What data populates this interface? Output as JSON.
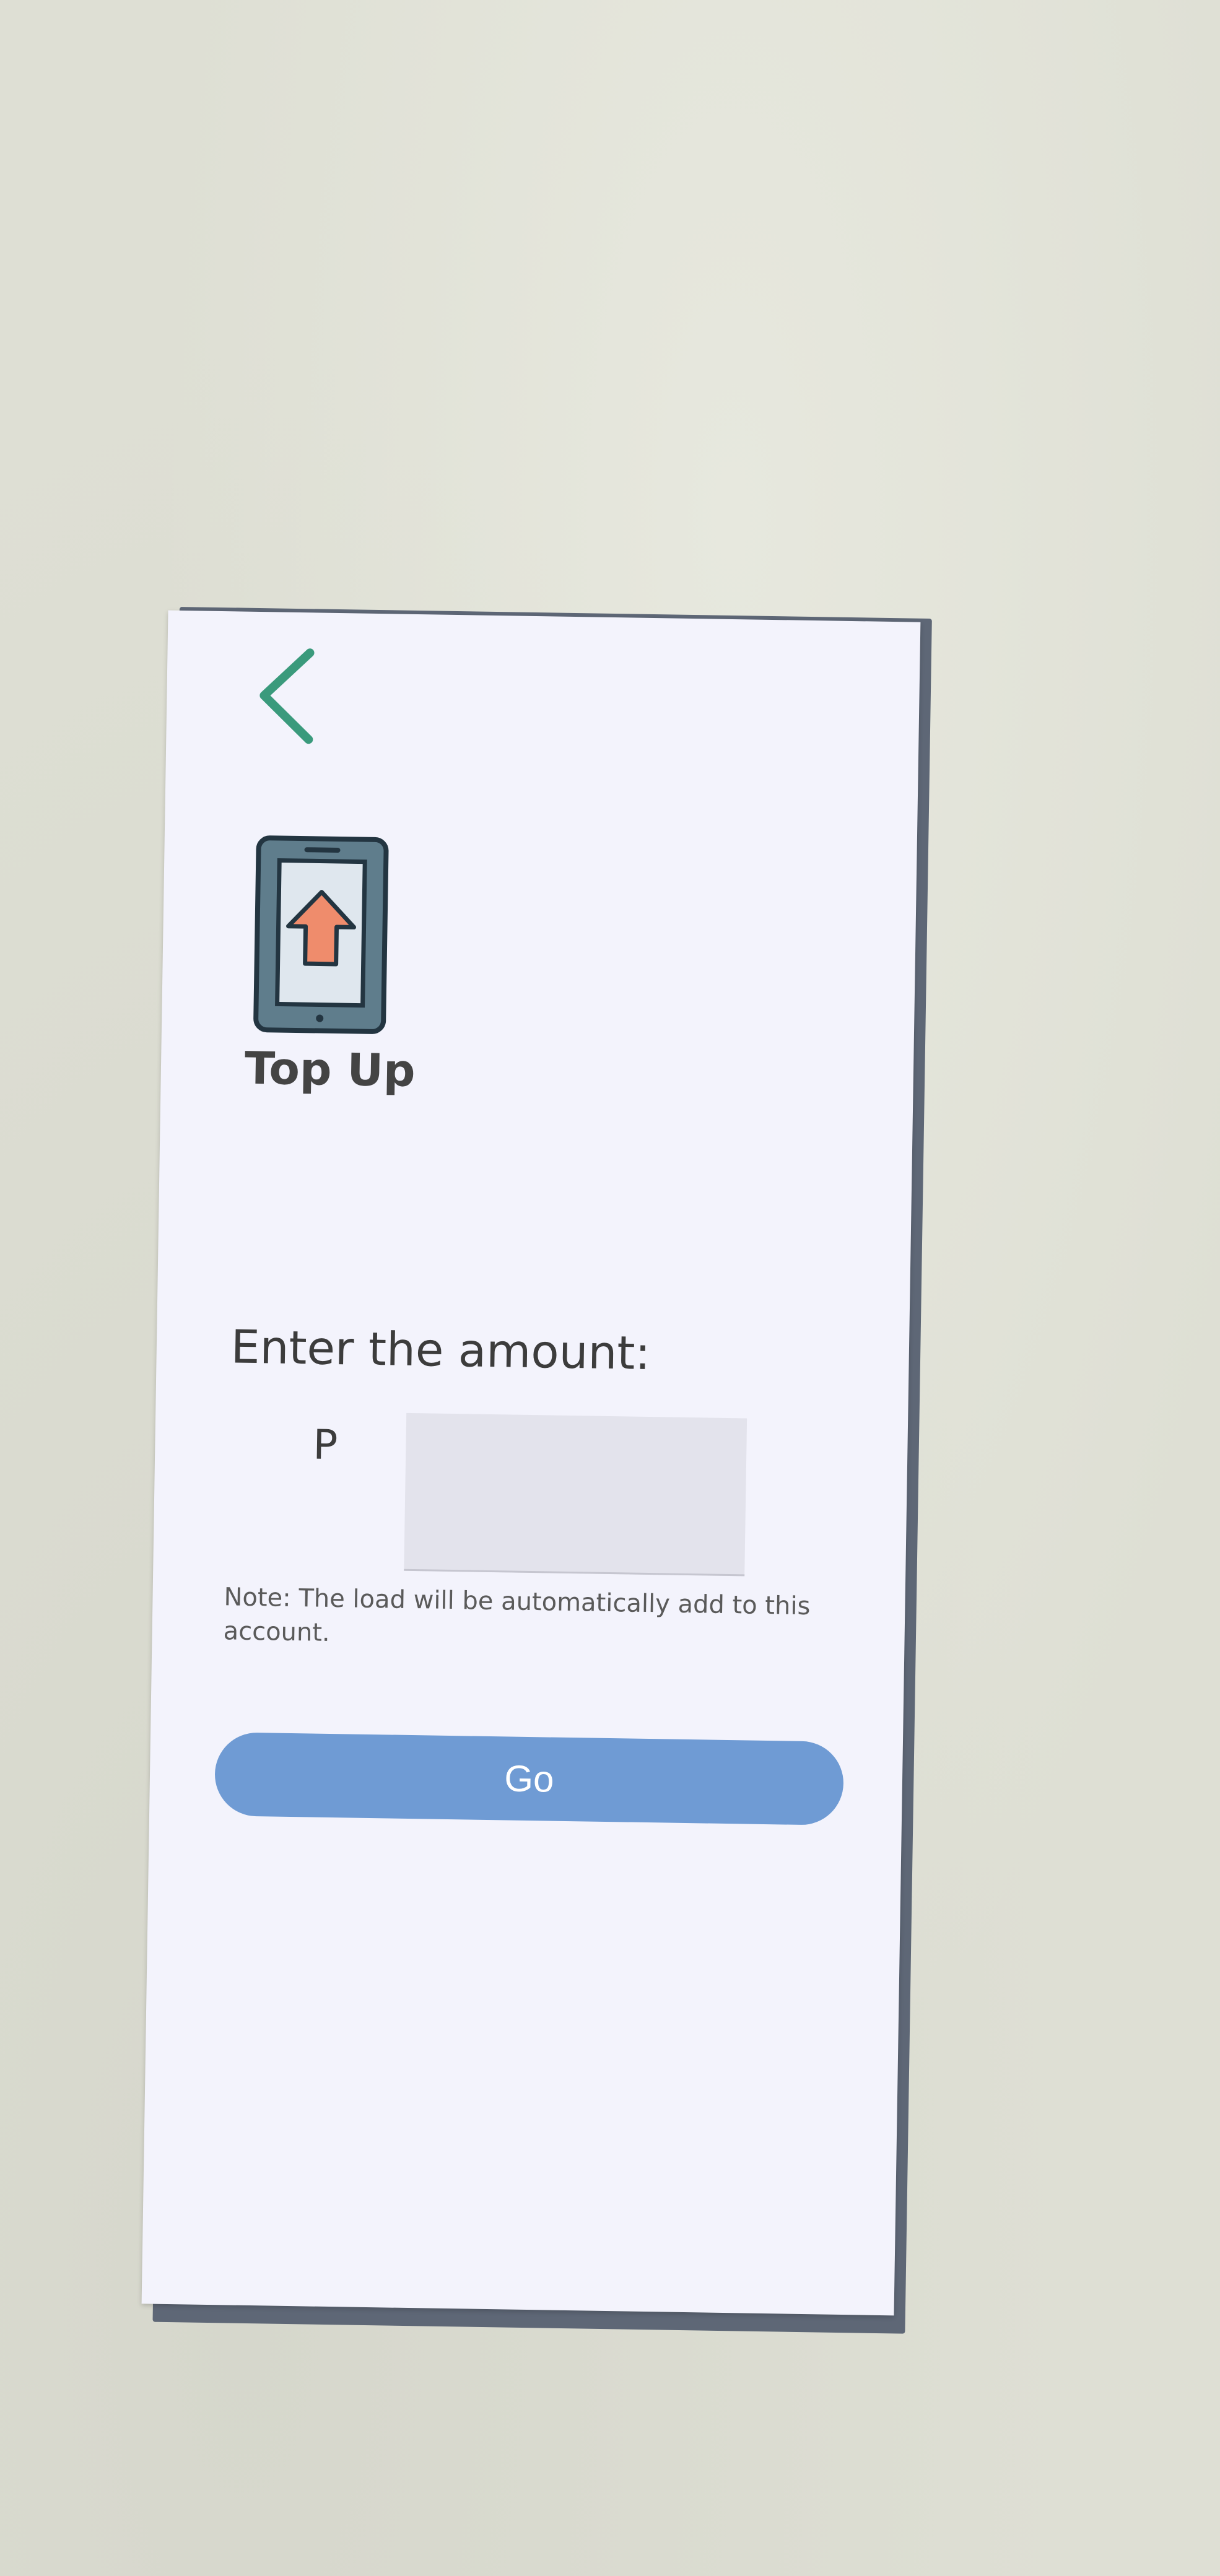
{
  "screen": {
    "title": "Top Up",
    "back_icon": "chevron-left-icon",
    "hero_icon": "phone-top-up-icon"
  },
  "form": {
    "amount_label": "Enter the amount:",
    "currency_symbol": "P",
    "amount_value": "",
    "amount_placeholder": ""
  },
  "note": "Note: The load will be automatically add to this account.",
  "actions": {
    "go_label": "Go"
  },
  "colors": {
    "back_chevron": "#3a9a7c",
    "primary_button": "#6f9bd4",
    "phone_body": "#5f7d8c",
    "arrow": "#ef8c6c"
  }
}
